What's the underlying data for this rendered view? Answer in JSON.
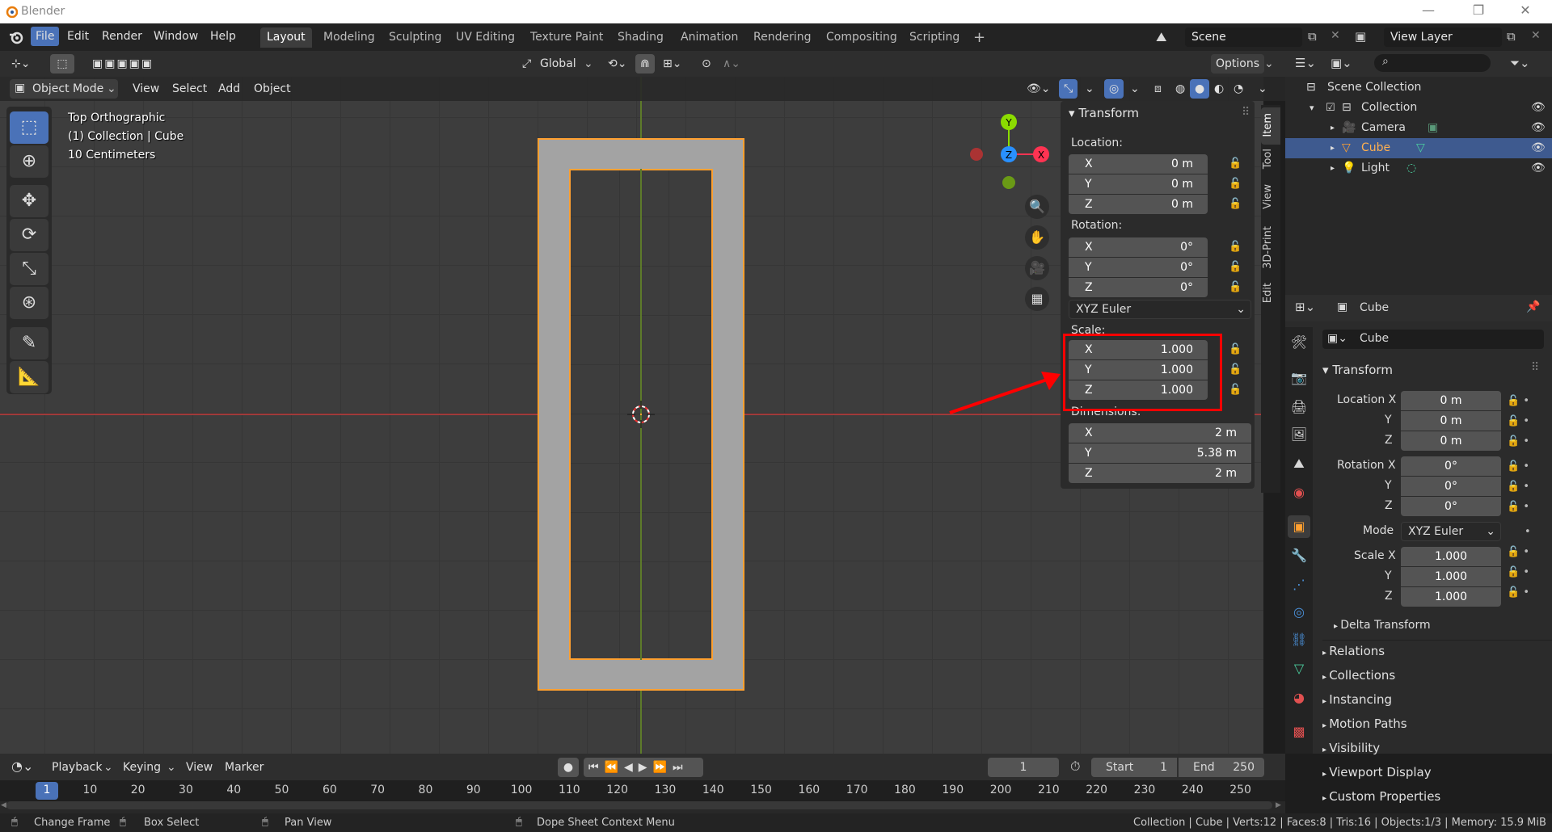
{
  "app": {
    "title": "Blender"
  },
  "menus": [
    "File",
    "Edit",
    "Render",
    "Window",
    "Help"
  ],
  "workspaces": [
    "Layout",
    "Modeling",
    "Sculpting",
    "UV Editing",
    "Texture Paint",
    "Shading",
    "Animation",
    "Rendering",
    "Compositing",
    "Scripting"
  ],
  "add_tab": "+",
  "scene": {
    "label": "Scene"
  },
  "view_layer": {
    "label": "View Layer"
  },
  "viewport": {
    "transform_orientation": "Global",
    "options": "Options",
    "mode": "Object Mode",
    "header_menus": [
      "View",
      "Select",
      "Add",
      "Object"
    ],
    "overlay_lines": [
      "Top Orthographic",
      "(1) Collection | Cube",
      "10 Centimeters"
    ],
    "gizmo": {
      "y": "Y",
      "z": "Z",
      "x": "X"
    }
  },
  "npanel": {
    "title": "Transform",
    "location_label": "Location:",
    "location": [
      {
        "k": "X",
        "v": "0 m"
      },
      {
        "k": "Y",
        "v": "0 m"
      },
      {
        "k": "Z",
        "v": "0 m"
      }
    ],
    "rotation_label": "Rotation:",
    "rotation": [
      {
        "k": "X",
        "v": "0°"
      },
      {
        "k": "Y",
        "v": "0°"
      },
      {
        "k": "Z",
        "v": "0°"
      }
    ],
    "rotation_mode": "XYZ Euler",
    "scale_label": "Scale:",
    "scale": [
      {
        "k": "X",
        "v": "1.000"
      },
      {
        "k": "Y",
        "v": "1.000"
      },
      {
        "k": "Z",
        "v": "1.000"
      }
    ],
    "dimensions_label": "Dimensions:",
    "dimensions": [
      {
        "k": "X",
        "v": "2 m"
      },
      {
        "k": "Y",
        "v": "5.38 m"
      },
      {
        "k": "Z",
        "v": "2 m"
      }
    ],
    "tabs": [
      "Item",
      "Tool",
      "View",
      "3D-Print",
      "Edit"
    ]
  },
  "outliner": {
    "root": "Scene Collection",
    "collection": "Collection",
    "items": [
      "Camera",
      "Cube",
      "Light"
    ]
  },
  "properties": {
    "object_name_header": "Cube",
    "object_name": "Cube",
    "section": "Transform",
    "location_label": "Location X",
    "location": [
      "0 m",
      "0 m",
      "0 m"
    ],
    "rotation_label": "Rotation X",
    "rotation": [
      "0°",
      "0°",
      "0°"
    ],
    "mode_label": "Mode",
    "mode_value": "XYZ Euler",
    "scale_label": "Scale X",
    "scale": [
      "1.000",
      "1.000",
      "1.000"
    ],
    "axis_y": "Y",
    "axis_z": "Z",
    "delta": "Delta Transform",
    "sections": [
      "Relations",
      "Collections",
      "Instancing",
      "Motion Paths",
      "Visibility",
      "Viewport Display",
      "Custom Properties"
    ]
  },
  "timeline": {
    "menus": [
      "Playback",
      "Keying",
      "View",
      "Marker"
    ],
    "current_frame": "1",
    "start_label": "Start",
    "start": "1",
    "end_label": "End",
    "end": "250",
    "ruler": [
      "1",
      "10",
      "20",
      "30",
      "40",
      "50",
      "60",
      "70",
      "80",
      "90",
      "100",
      "110",
      "120",
      "130",
      "140",
      "150",
      "160",
      "170",
      "180",
      "190",
      "200",
      "210",
      "220",
      "230",
      "240",
      "250"
    ]
  },
  "statusbar": {
    "change_frame": "Change Frame",
    "box_select": "Box Select",
    "pan_view": "Pan View",
    "context_menu": "Dope Sheet Context Menu",
    "stats": "Collection | Cube | Verts:12 | Faces:8 | Tris:16 | Objects:1/3 | Memory: 15.9 MiB"
  },
  "colors": {
    "accent": "#4a72b8",
    "selection": "#ffa030",
    "highlight_box": "#ff0000",
    "x_axis": "#ff3352",
    "y_axis": "#8bdc00",
    "z_axis": "#2890ff"
  }
}
